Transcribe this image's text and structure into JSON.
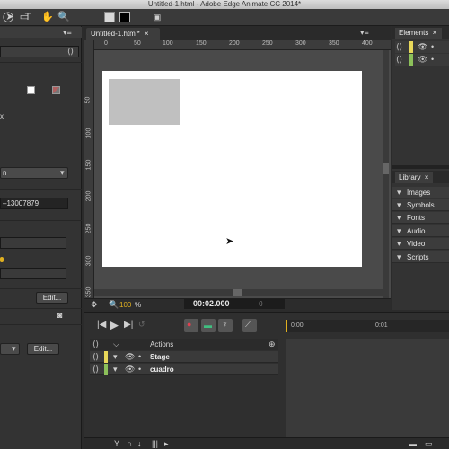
{
  "window": {
    "title": "Untitled-1.html - Adobe Edge Animate CC 2014*"
  },
  "toolbar": {
    "tools": [
      "arrow-tool",
      "rectangle-tool",
      "ellipse-tool",
      "text-tool",
      "hand-tool",
      "zoom-tool"
    ],
    "fill_swatch_color": "#d8d8d8",
    "stroke_swatch_color": "#000000"
  },
  "properties": {
    "position_label": "x",
    "text_partial": "n",
    "id_value": "–13007879",
    "edit_label_1": "Edit...",
    "edit_label_2": "Edit..."
  },
  "document": {
    "tab_label": "Untitled-1.html*",
    "hruler_ticks": [
      "0",
      "50",
      "100",
      "150",
      "200",
      "250",
      "300",
      "350",
      "400"
    ],
    "vruler_ticks": [
      "50",
      "100",
      "150",
      "200",
      "250",
      "300",
      "350"
    ],
    "zoom": "100",
    "zoom_unit": "%",
    "time": "00:02.000",
    "time_aux": "0",
    "stage_color": "#ffffff",
    "element_color": "#c0c0c0"
  },
  "elements_panel": {
    "title": "Elements"
  },
  "library": {
    "title": "Library",
    "items": [
      "Images",
      "Symbols",
      "Fonts",
      "Audio",
      "Video",
      "Scripts"
    ]
  },
  "timeline": {
    "actions_label": "Actions",
    "time_marks": [
      "0:00",
      "0:01"
    ],
    "rows": [
      {
        "name": "Stage",
        "color": "#e8d85a"
      },
      {
        "name": "cuadro",
        "color": "#8cc05a"
      }
    ]
  }
}
